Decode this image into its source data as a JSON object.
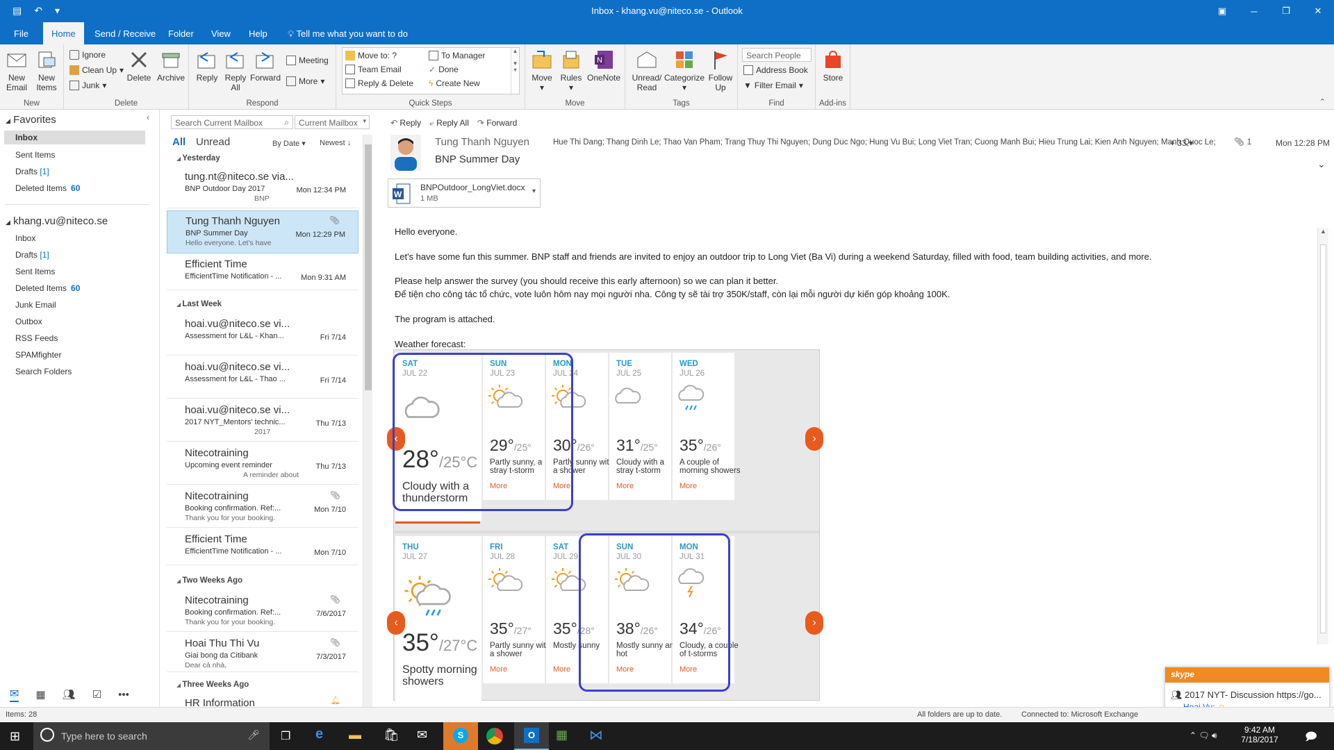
{
  "window": {
    "title": "Inbox - khang.vu@niteco.se  -  Outlook"
  },
  "tabs": [
    "File",
    "Home",
    "Send / Receive",
    "Folder",
    "View",
    "Help",
    "Tell me what you want to do"
  ],
  "ribbon": {
    "new": {
      "new_email": "New\nEmail",
      "new_items": "New\nItems",
      "label": "New"
    },
    "delete": {
      "ignore": "Ignore",
      "cleanup": "Clean Up",
      "junk": "Junk",
      "delete": "Delete",
      "archive": "Archive",
      "label": "Delete"
    },
    "respond": {
      "reply": "Reply",
      "reply_all": "Reply\nAll",
      "forward": "Forward",
      "meeting": "Meeting",
      "more": "More",
      "label": "Respond"
    },
    "quick_steps": {
      "items": [
        "Move to: ?",
        "Team Email",
        "Reply & Delete",
        "To Manager",
        "Done",
        "Create New"
      ],
      "label": "Quick Steps"
    },
    "move": {
      "move": "Move",
      "rules": "Rules",
      "onenote": "OneNote",
      "label": "Move"
    },
    "tags": {
      "unread": "Unread/\nRead",
      "categorize": "Categorize",
      "follow_up": "Follow\nUp",
      "label": "Tags"
    },
    "find": {
      "search_people": "Search People",
      "address_book": "Address Book",
      "filter_email": "Filter Email",
      "label": "Find"
    },
    "addins": {
      "store": "Store",
      "label": "Add-ins"
    }
  },
  "nav": {
    "favorites": "Favorites",
    "fav_items": [
      {
        "label": "Inbox",
        "count": ""
      },
      {
        "label": "Sent Items",
        "count": ""
      },
      {
        "label": "Drafts",
        "count": "[1]"
      },
      {
        "label": "Deleted Items",
        "count": "60"
      }
    ],
    "account": "khang.vu@niteco.se",
    "acc_items": [
      {
        "label": "Inbox",
        "count": ""
      },
      {
        "label": "Drafts",
        "count": "[1]"
      },
      {
        "label": "Sent Items",
        "count": ""
      },
      {
        "label": "Deleted Items",
        "count": "60"
      },
      {
        "label": "Junk Email",
        "count": ""
      },
      {
        "label": "Outbox",
        "count": ""
      },
      {
        "label": "RSS Feeds",
        "count": ""
      },
      {
        "label": "SPAMfighter",
        "count": ""
      },
      {
        "label": "Search Folders",
        "count": ""
      }
    ]
  },
  "list": {
    "search_placeholder": "Search Current Mailbox",
    "scope": "Current Mailbox",
    "filter_all": "All",
    "filter_unread": "Unread",
    "sort_by": "By Date",
    "sort_order": "Newest",
    "groups": [
      "Yesterday",
      "Last Week",
      "Two Weeks Ago",
      "Three Weeks Ago"
    ],
    "messages": [
      {
        "from": "tung.nt@niteco.se via...",
        "subject": "BNP Outdoor Day 2017",
        "date": "Mon 12:34 PM",
        "preview": "BNP"
      },
      {
        "from": "Tung Thanh Nguyen",
        "subject": "BNP Summer Day",
        "date": "Mon 12:29 PM",
        "preview": "Hello everyone.  Let's have"
      },
      {
        "from": "Efficient Time",
        "subject": "EfficientTime Notification - ...",
        "date": "Mon 9:31 AM",
        "preview": ""
      },
      {
        "from": "hoai.vu@niteco.se vi...",
        "subject": "Assessment for L&L - Khan...",
        "date": "Fri 7/14",
        "preview": ""
      },
      {
        "from": "hoai.vu@niteco.se vi...",
        "subject": "Assessment for L&L - Thao ...",
        "date": "Fri 7/14",
        "preview": ""
      },
      {
        "from": "hoai.vu@niteco.se vi...",
        "subject": "2017 NYT_Mentors' technic...",
        "date": "Thu 7/13",
        "preview": "2017"
      },
      {
        "from": "Nitecotraining",
        "subject": "Upcoming event reminder",
        "date": "Thu 7/13",
        "preview": "A reminder about"
      },
      {
        "from": "Nitecotraining",
        "subject": "Booking confirmation. Ref:...",
        "date": "Mon 7/10",
        "preview": "Thank you for your booking."
      },
      {
        "from": "Efficient Time",
        "subject": "EfficientTime Notification - ...",
        "date": "Mon 7/10",
        "preview": ""
      },
      {
        "from": "Nitecotraining",
        "subject": "Booking confirmation. Ref:...",
        "date": "7/6/2017",
        "preview": "Thank you for your booking."
      },
      {
        "from": "Hoai Thu Thi Vu",
        "subject": "Giai bong da Citibank",
        "date": "7/3/2017",
        "preview": "Dear cả nhà,"
      },
      {
        "from": "HR Information",
        "subject": "",
        "date": "",
        "preview": ""
      }
    ]
  },
  "reading": {
    "actions": [
      "Reply",
      "Reply All",
      "Forward"
    ],
    "sender": "Tung Thanh Nguyen",
    "subject": "BNP Summer Day",
    "recipients": "Hue Thi Dang; Thang Dinh Le; Thao Van Pham; Trang Thuy Thi Nguyen; Dung Duc Ngo; Hung Vu Bui; Long Viet Tran; Cuong Manh Bui; Hieu Trung Lai; Kien Anh Nguyen; Manh Quoc Le;",
    "more_recipients": "+ 33",
    "attach_count": "1",
    "time": "Mon 12:28 PM",
    "attachment": {
      "name": "BNPOutdoor_LongViet.docx",
      "size": "1 MB"
    },
    "body": [
      "Hello everyone.",
      "Let's have some fun this summer. BNP staff and friends are invited to enjoy an outdoor trip to Long Viet (Ba Vi) during a weekend Saturday, filled with food, team building activities, and more.",
      "Please help answer the survey (you should receive this early afternoon) so we can plan it better.",
      "Để tiện cho công tác tổ chức, vote luôn hôm nay mọi người nha. Công ty sẽ tài trợ 350K/staff, còn lại mỗi người dự kiến góp khoảng 100K.",
      "The program is attached.",
      "Weather forecast:"
    ],
    "more_label": "More",
    "weather_row1": [
      {
        "day": "SAT",
        "date": "JUL 22",
        "hi": "28°",
        "lo": "/25°C",
        "desc": "Cloudy with a thunderstorm",
        "icon": "cloud"
      },
      {
        "day": "SUN",
        "date": "JUL 23",
        "hi": "29°",
        "lo": "/25°",
        "desc": "Partly sunny, a stray t-storm",
        "icon": "sun-cloud"
      },
      {
        "day": "MON",
        "date": "JUL 24",
        "hi": "30°",
        "lo": "/26°",
        "desc": "Partly sunny with a shower",
        "icon": "sun-cloud"
      },
      {
        "day": "TUE",
        "date": "JUL 25",
        "hi": "31°",
        "lo": "/25°",
        "desc": "Cloudy with a stray t-storm",
        "icon": "cloud"
      },
      {
        "day": "WED",
        "date": "JUL 26",
        "hi": "35°",
        "lo": "/26°",
        "desc": "A couple of morning showers",
        "icon": "cloud-rain"
      }
    ],
    "weather_row2": [
      {
        "day": "THU",
        "date": "JUL 27",
        "hi": "35°",
        "lo": "/27°C",
        "desc": "Spotty morning showers",
        "icon": "sun-rain"
      },
      {
        "day": "FRI",
        "date": "JUL 28",
        "hi": "35°",
        "lo": "/27°",
        "desc": "Partly sunny with a shower",
        "icon": "sun-cloud"
      },
      {
        "day": "SAT",
        "date": "JUL 29",
        "hi": "35°",
        "lo": "/28°",
        "desc": "Mostly sunny",
        "icon": "sun-cloud"
      },
      {
        "day": "SUN",
        "date": "JUL 30",
        "hi": "38°",
        "lo": "/26°",
        "desc": "Mostly sunny and hot",
        "icon": "sun-cloud"
      },
      {
        "day": "MON",
        "date": "JUL 31",
        "hi": "34°",
        "lo": "/26°",
        "desc": "Cloudy, a couple of t-storms",
        "icon": "cloud-storm"
      }
    ]
  },
  "status": {
    "items": "Items: 28",
    "sync": "All folders are up to date.",
    "connection": "Connected to: Microsoft Exchange"
  },
  "skype": {
    "brand": "skype",
    "chat": "2017 NYT- Discussion https://go...",
    "from": "Hoai Vu:"
  },
  "taskbar": {
    "search_placeholder": "Type here to search",
    "time": "9:42 AM",
    "date": "7/18/2017"
  },
  "colors": {
    "accent": "#0f6fc6",
    "orange": "#e85b1e",
    "weather_day": "#2a97c8",
    "highlight": "#3a3fcf"
  }
}
